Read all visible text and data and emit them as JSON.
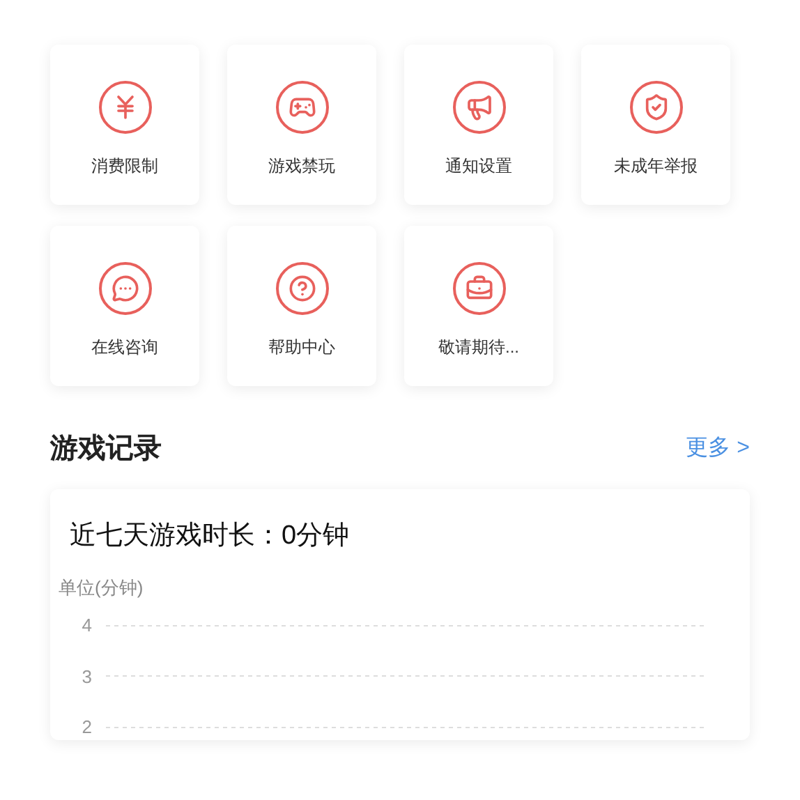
{
  "tiles": [
    {
      "label": "消费限制",
      "kind": "yen"
    },
    {
      "label": "游戏禁玩",
      "kind": "gamepad"
    },
    {
      "label": "通知设置",
      "kind": "megaphone"
    },
    {
      "label": "未成年举报",
      "kind": "shield"
    },
    {
      "label": "在线咨询",
      "kind": "chat"
    },
    {
      "label": "帮助中心",
      "kind": "help"
    },
    {
      "label": "敬请期待...",
      "kind": "toolbox"
    }
  ],
  "records": {
    "title": "游戏记录",
    "more": "更多 >",
    "summary": "近七天游戏时长：0分钟",
    "y_axis": {
      "unit": "单位(分钟)",
      "ticks": [
        "4",
        "3",
        "2"
      ]
    }
  }
}
